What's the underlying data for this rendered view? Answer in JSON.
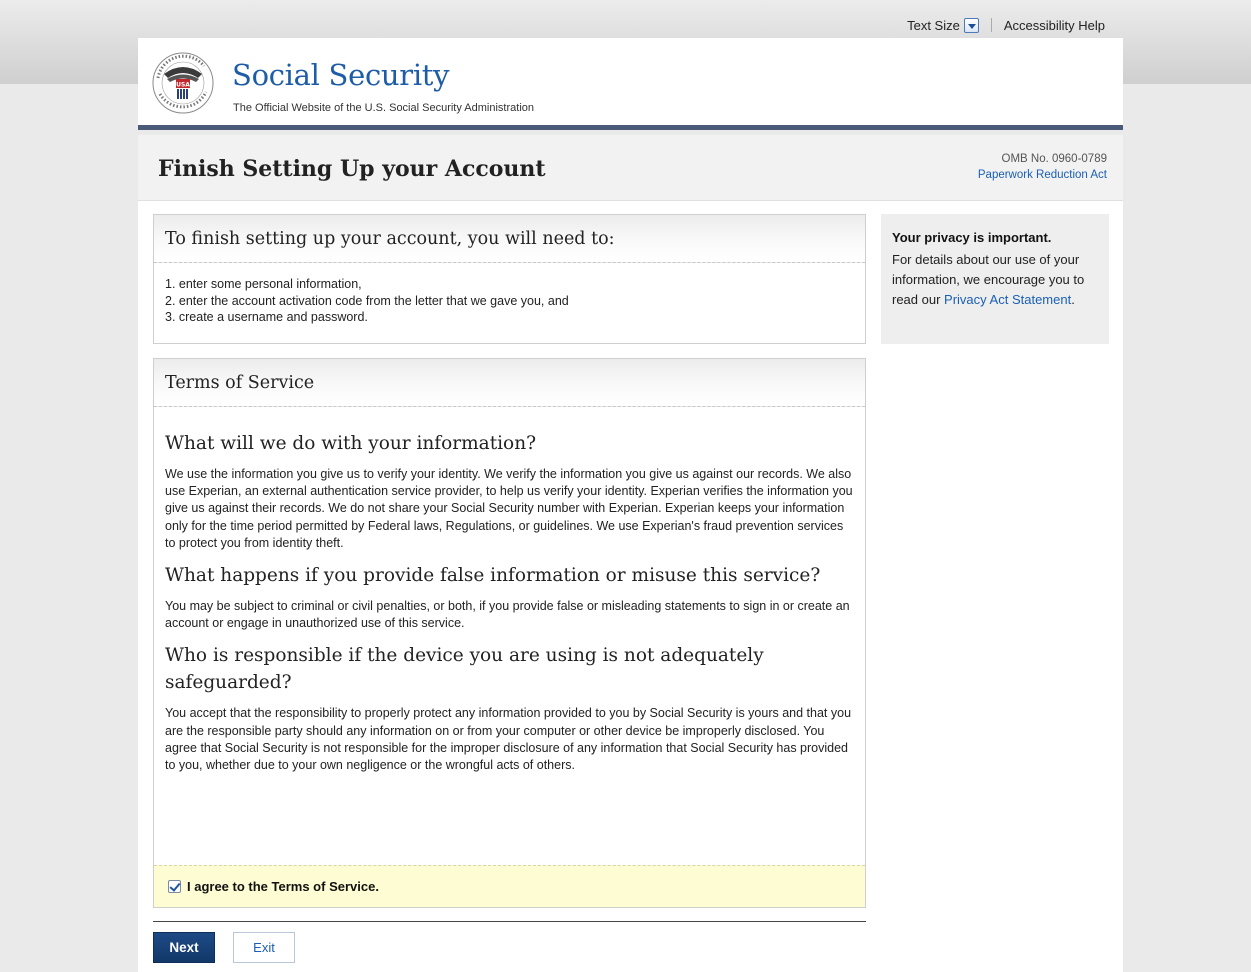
{
  "utility": {
    "text_size_label": "Text Size",
    "accessibility_help": "Accessibility Help"
  },
  "brand": {
    "title": "Social Security",
    "subtitle": "The Official Website of the U.S. Social Security Administration",
    "seal_text": "SOCIAL SECURITY ADMINISTRATION USA"
  },
  "page": {
    "title": "Finish Setting Up your Account",
    "omb_number": "OMB No. 0960-0789",
    "paperwork_link": "Paperwork Reduction Act"
  },
  "intro": {
    "heading": "To finish setting up your account, you will need to:",
    "steps": [
      "1. enter some personal information,",
      "2. enter the account activation code from the letter that we gave you, and",
      "3. create a username and password."
    ]
  },
  "tos": {
    "heading": "Terms of Service",
    "sections": [
      {
        "title": "What will we do with your information?",
        "body": "We use the information you give us to verify your identity. We verify the information you give us against our records. We also use Experian, an external authentication service provider, to help us verify your identity. Experian verifies the information you give us against their records. We do not share your Social Security number with Experian. Experian keeps your information only for the time period permitted by Federal laws, Regulations, or guidelines. We use Experian's fraud prevention services to protect you from identity theft."
      },
      {
        "title": "What happens if you provide false information or misuse this service?",
        "body": "You may be subject to criminal or civil penalties, or both, if you provide false or misleading statements to sign in or create an account or engage in unauthorized use of this service."
      },
      {
        "title": "Who is responsible if the device you are using is not adequately safeguarded?",
        "body": "You accept that the responsibility to properly protect any information provided to you by Social Security is yours and that you are the responsible party should any information on or from your computer or other device be improperly disclosed. You agree that Social Security is not responsible for the improper disclosure of any information that Social Security has provided to you, whether due to your own negligence or the wrongful acts of others."
      }
    ],
    "agree_label": "I agree to the Terms of Service.",
    "agree_checked": true
  },
  "buttons": {
    "next": "Next",
    "exit": "Exit"
  },
  "sidebar": {
    "heading": "Your privacy is important.",
    "text": "For details about our use of your information, we encourage you to read our",
    "link": "Privacy Act Statement",
    "tail": "."
  },
  "colors": {
    "brand_blue": "#1d5ca7",
    "header_rule": "#4c5a79",
    "next_button": "#1d4a86",
    "agree_bg": "#fdfcd2"
  }
}
